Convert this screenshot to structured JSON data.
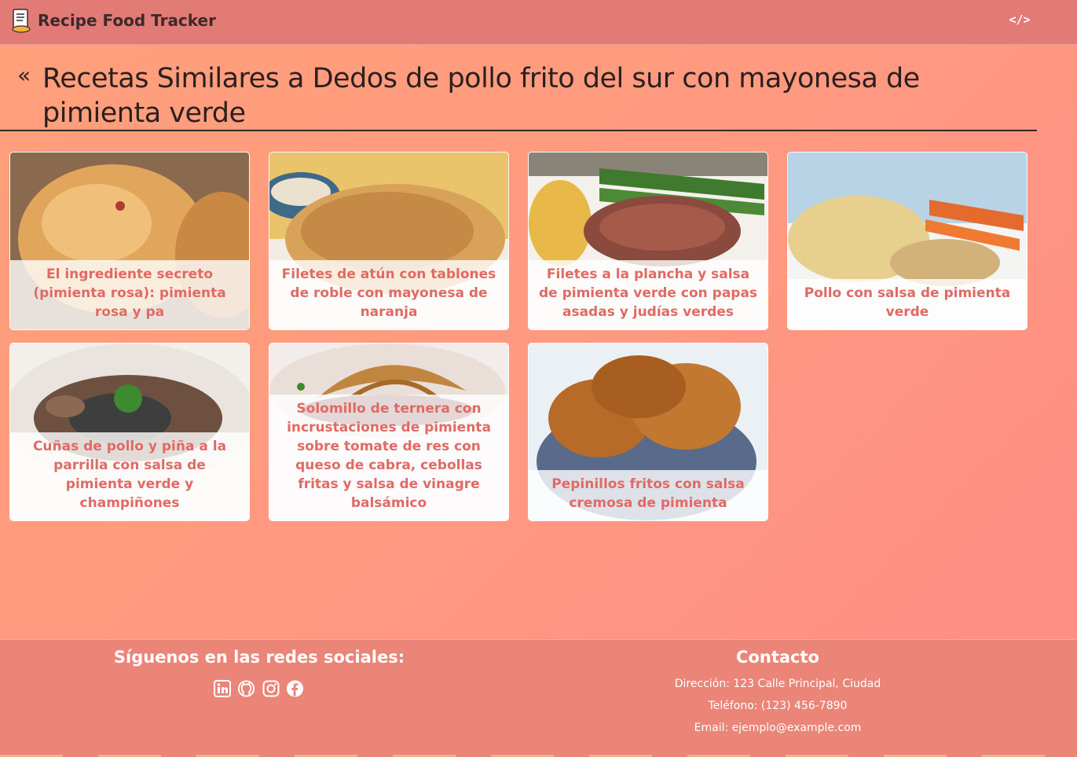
{
  "app": {
    "title": "Recipe Food Tracker",
    "code_icon": "code-icon"
  },
  "header": {
    "back_symbol": "«",
    "title": "Recetas Similares a Dedos de pollo frito del sur con mayonesa de pimienta verde"
  },
  "recipes": [
    {
      "label": "El ingrediente secreto (pimienta rosa): pimienta rosa y pa"
    },
    {
      "label": "Filetes de atún con tablones de roble con mayonesa de naranja"
    },
    {
      "label": "Filetes a la plancha y salsa de pimienta verde con papas asadas y judías verdes"
    },
    {
      "label": "Pollo con salsa de pimienta verde"
    },
    {
      "label": "Cuñas de pollo y piña a la parrilla con salsa de pimienta verde y champiñones"
    },
    {
      "label": "Solomillo de ternera con incrustaciones de pimienta sobre tomate de res con queso de cabra, cebollas fritas y salsa de vinagre balsámico"
    },
    {
      "label": "Pepinillos fritos con salsa cremosa de pimienta"
    }
  ],
  "footer": {
    "social_heading": "Síguenos en las redes sociales:",
    "social_icons": [
      "linkedin-icon",
      "github-icon",
      "instagram-icon",
      "facebook-icon"
    ],
    "contact_heading": "Contacto",
    "address": "Dirección: 123 Calle Principal, Ciudad",
    "phone": "Teléfono: (123) 456-7890",
    "email": "Email: ejemplo@example.com"
  },
  "colors": {
    "navbar": "#e27a76",
    "card_text": "#e06a64",
    "footer": "#ea8578"
  }
}
